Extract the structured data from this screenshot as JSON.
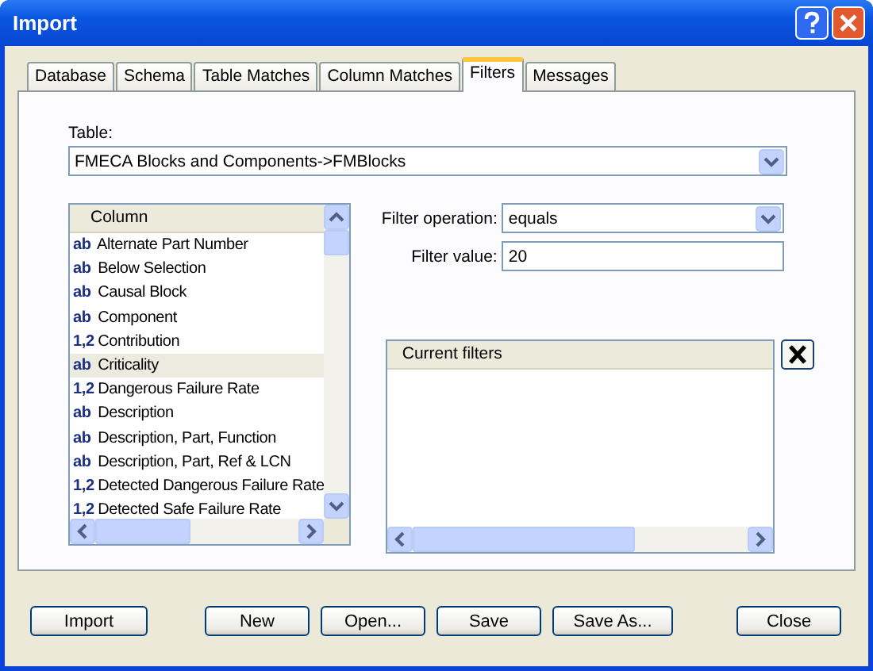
{
  "window": {
    "title": "Import"
  },
  "tabs": [
    {
      "label": "Database",
      "selected": false
    },
    {
      "label": "Schema",
      "selected": false
    },
    {
      "label": "Table Matches",
      "selected": false
    },
    {
      "label": "Column Matches",
      "selected": false
    },
    {
      "label": "Filters",
      "selected": true
    },
    {
      "label": "Messages",
      "selected": false
    }
  ],
  "table": {
    "label": "Table:",
    "value": "FMECA Blocks and Components->FMBlocks"
  },
  "column_list": {
    "header": "Column",
    "items": [
      {
        "type_label": "ab",
        "name": "Alternate Part Number",
        "selected": false
      },
      {
        "type_label": "ab",
        "name": "Below Selection",
        "selected": false
      },
      {
        "type_label": "ab",
        "name": "Causal Block",
        "selected": false
      },
      {
        "type_label": "ab",
        "name": "Component",
        "selected": false
      },
      {
        "type_label": "1,2",
        "name": "Contribution",
        "selected": false
      },
      {
        "type_label": "ab",
        "name": "Criticality",
        "selected": true
      },
      {
        "type_label": "1,2",
        "name": "Dangerous Failure Rate",
        "selected": false
      },
      {
        "type_label": "ab",
        "name": "Description",
        "selected": false
      },
      {
        "type_label": "ab",
        "name": "Description, Part, Function",
        "selected": false
      },
      {
        "type_label": "ab",
        "name": "Description, Part, Ref & LCN",
        "selected": false
      },
      {
        "type_label": "1,2",
        "name": "Detected Dangerous Failure Rate",
        "selected": false
      },
      {
        "type_label": "1,2",
        "name": "Detected Safe Failure Rate",
        "selected": false
      }
    ]
  },
  "filter_operation": {
    "label": "Filter operation:",
    "value": "equals"
  },
  "filter_value": {
    "label": "Filter value:",
    "value": "20"
  },
  "current_filters": {
    "header": "Current filters"
  },
  "buttons": [
    "Import",
    "New",
    "Open...",
    "Save",
    "Save As...",
    "Close"
  ]
}
